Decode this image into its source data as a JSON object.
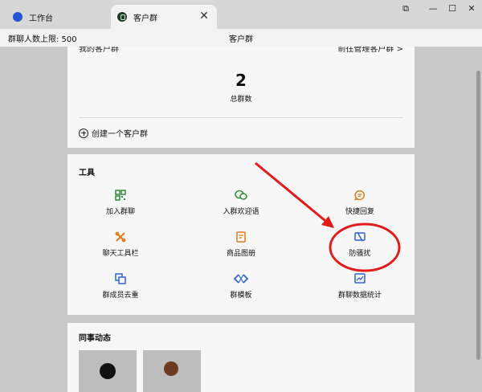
{
  "tabs": [
    {
      "label": "工作台",
      "icon": "globe-icon"
    },
    {
      "label": "客户群",
      "icon": "group-icon"
    }
  ],
  "window_controls": [
    "pin-icon",
    "minimize-icon",
    "maximize-icon",
    "close-icon"
  ],
  "header": {
    "limit_text": "群聊人数上限: 500",
    "title": "客户群"
  },
  "my_groups": {
    "cut_title": "我的客户群",
    "cut_right": "前往管理客户群 >",
    "count": "2",
    "count_label": "总群数",
    "create_label": "创建一个客户群"
  },
  "tools": {
    "title": "工具",
    "items": [
      {
        "label": "加入群聊",
        "icon": "qrcode-icon"
      },
      {
        "label": "入群欢迎语",
        "icon": "chat-bubble-icon"
      },
      {
        "label": "快捷回复",
        "icon": "quick-reply-icon"
      },
      {
        "label": "聊天工具栏",
        "icon": "toolbar-icon"
      },
      {
        "label": "商品图册",
        "icon": "catalog-icon"
      },
      {
        "label": "防骚扰",
        "icon": "anti-harass-icon"
      },
      {
        "label": "群成员去重",
        "icon": "dedupe-icon"
      },
      {
        "label": "群模板",
        "icon": "template-icon"
      },
      {
        "label": "群聊数据统计",
        "icon": "stats-icon"
      }
    ]
  },
  "colleague": {
    "title": "同事动态"
  },
  "colors": {
    "accent_green": "#2f8a35",
    "accent_orange": "#e07b1a",
    "accent_blue": "#2f62d6",
    "annotation_red": "#e41b1b"
  }
}
